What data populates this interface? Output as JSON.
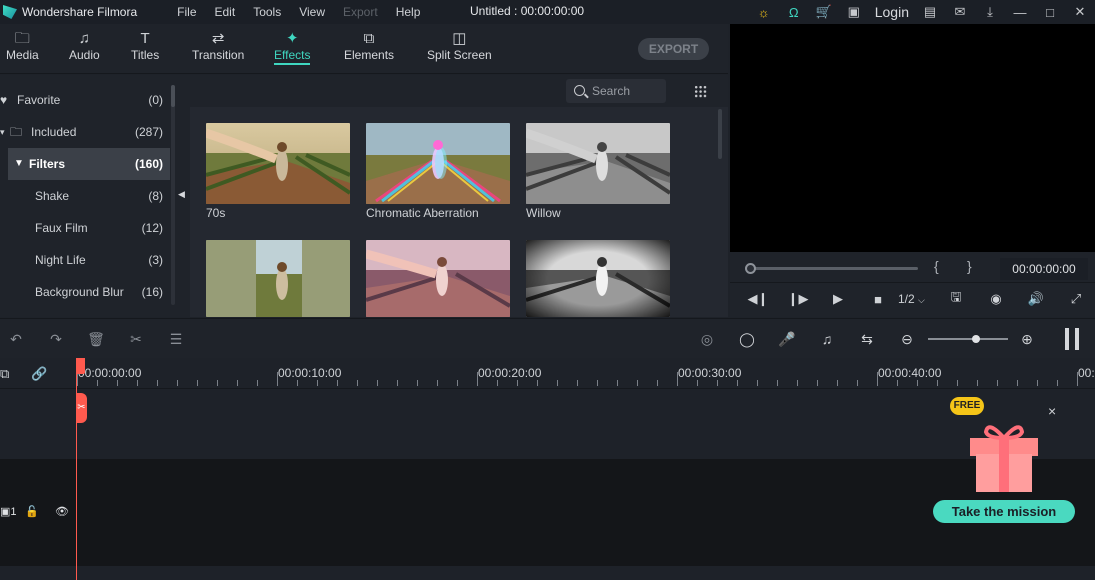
{
  "app": {
    "name": "Wondershare Filmora",
    "document_title": "Untitled : 00:00:00:00",
    "menu": [
      {
        "label": "File",
        "enabled": true
      },
      {
        "label": "Edit",
        "enabled": true
      },
      {
        "label": "Tools",
        "enabled": true
      },
      {
        "label": "View",
        "enabled": true
      },
      {
        "label": "Export",
        "enabled": false
      },
      {
        "label": "Help",
        "enabled": true
      }
    ],
    "login_label": "Login",
    "titlebar_icons": [
      "lightbulb-icon",
      "headset-icon",
      "cart-icon",
      "gift-icon",
      "login",
      "save-icon",
      "mail-icon",
      "download-icon",
      "minimize-icon",
      "maximize-icon",
      "close-icon"
    ]
  },
  "mediabar": {
    "tabs": [
      {
        "label": "Media",
        "icon": "folder-icon",
        "active": false
      },
      {
        "label": "Audio",
        "icon": "music-note-icon",
        "active": false
      },
      {
        "label": "Titles",
        "icon": "text-icon",
        "active": false
      },
      {
        "label": "Transition",
        "icon": "transition-icon",
        "active": false
      },
      {
        "label": "Effects",
        "icon": "sparkle-icon",
        "active": true
      },
      {
        "label": "Elements",
        "icon": "elements-icon",
        "active": false
      },
      {
        "label": "Split Screen",
        "icon": "split-screen-icon",
        "active": false
      }
    ],
    "export_label": "EXPORT"
  },
  "sidebar": {
    "items": [
      {
        "name": "Favorite",
        "count": "(0)",
        "icon": "heart-icon"
      },
      {
        "name": "Included",
        "count": "(287)",
        "icon": "folder-icon"
      },
      {
        "name": "Filters",
        "count": "(160)",
        "icon": "triangle-down-icon",
        "selected": true
      },
      {
        "name": "Shake",
        "count": "(8)"
      },
      {
        "name": "Faux Film",
        "count": "(12)"
      },
      {
        "name": "Night Life",
        "count": "(3)"
      },
      {
        "name": "Background Blur",
        "count": "(16)"
      }
    ]
  },
  "effects": {
    "search_placeholder": "Search",
    "items": [
      {
        "label": "70s",
        "style": "warm"
      },
      {
        "label": "Chromatic Aberration",
        "style": "chromatic"
      },
      {
        "label": "Willow",
        "style": "bw"
      },
      {
        "label": "",
        "style": "split-blur"
      },
      {
        "label": "",
        "style": "pink"
      },
      {
        "label": "",
        "style": "bw-grain"
      }
    ]
  },
  "preview": {
    "timecode": "00:00:00:00",
    "mark_in": "{",
    "mark_out": "}",
    "zoom": "1/2"
  },
  "timeline": {
    "ruler_labels": [
      "00:00:00:00",
      "00:00:10:00",
      "00:00:20:00",
      "00:00:30:00",
      "00:00:40:00",
      "00:"
    ],
    "track_number": "1"
  },
  "promo": {
    "badge": "FREE",
    "button_label": "Take the mission",
    "close": "×"
  },
  "colors": {
    "accent": "#3fd6c0",
    "playhead": "#ff5a4e",
    "mission_button": "#4ad9c0"
  }
}
